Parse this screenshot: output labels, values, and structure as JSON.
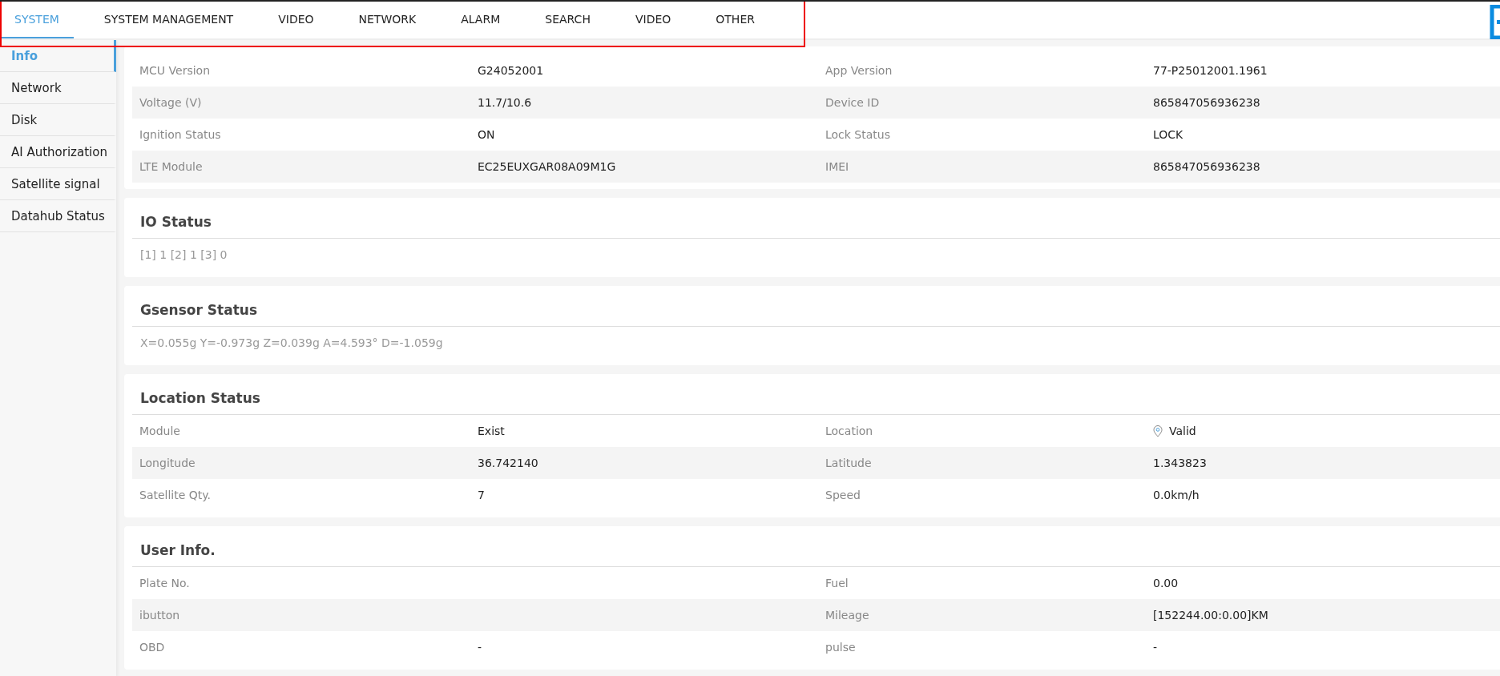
{
  "tabs": [
    {
      "label": "SYSTEM",
      "selected": true
    },
    {
      "label": "SYSTEM MANAGEMENT",
      "selected": false
    },
    {
      "label": "VIDEO",
      "selected": false
    },
    {
      "label": "NETWORK",
      "selected": false
    },
    {
      "label": "ALARM",
      "selected": false
    },
    {
      "label": "SEARCH",
      "selected": false
    },
    {
      "label": "VIDEO",
      "selected": false
    },
    {
      "label": "OTHER",
      "selected": false
    }
  ],
  "sidebar": {
    "items": [
      {
        "label": "Info",
        "selected": true
      },
      {
        "label": "Network",
        "selected": false
      },
      {
        "label": "Disk",
        "selected": false
      },
      {
        "label": "AI Authorization",
        "selected": false
      },
      {
        "label": "Satellite signal",
        "selected": false
      },
      {
        "label": "Datahub Status",
        "selected": false
      }
    ]
  },
  "cards": [
    {
      "kind": "grid",
      "rows": [
        {
          "cells": [
            {
              "label": "MCU Version",
              "value": "G24052001",
              "kind": "text"
            },
            {
              "label": "App Version",
              "value": "77-P25012001.1961",
              "kind": "text"
            }
          ]
        },
        {
          "cells": [
            {
              "label": "Voltage (V)",
              "value": "11.7/10.6",
              "kind": "text"
            },
            {
              "label": "Device ID",
              "value": "865847056936238",
              "kind": "text"
            }
          ]
        },
        {
          "cells": [
            {
              "label": "Ignition Status",
              "value": "ON",
              "kind": "text"
            },
            {
              "label": "Lock Status",
              "value": "LOCK",
              "kind": "text"
            }
          ]
        },
        {
          "cells": [
            {
              "label": "LTE Module",
              "value": "EC25EUXGAR08A09M1G",
              "kind": "text"
            },
            {
              "label": "IMEI",
              "value": "865847056936238",
              "kind": "text"
            }
          ]
        }
      ]
    },
    {
      "kind": "text",
      "title": "IO Status",
      "text": "[1] 1 [2] 1 [3] 0"
    },
    {
      "kind": "text",
      "title": "Gsensor Status",
      "text": "X=0.055g Y=-0.973g Z=0.039g A=4.593° D=-1.059g"
    },
    {
      "kind": "grid",
      "title": "Location Status",
      "rows": [
        {
          "cells": [
            {
              "label": "Module",
              "value": "Exist",
              "kind": "text"
            },
            {
              "label": "Location",
              "value": "Valid",
              "kind": "pin"
            }
          ]
        },
        {
          "cells": [
            {
              "label": "Longitude",
              "value": "36.742140",
              "kind": "text"
            },
            {
              "label": "Latitude",
              "value": "1.343823",
              "kind": "text"
            }
          ]
        },
        {
          "cells": [
            {
              "label": "Satellite Qty.",
              "value": "7",
              "kind": "text"
            },
            {
              "label": "Speed",
              "value": "0.0km/h",
              "kind": "text"
            }
          ]
        }
      ]
    },
    {
      "kind": "grid",
      "title": "User Info.",
      "rows": [
        {
          "cells": [
            {
              "label": "Plate No.",
              "kind": "text"
            },
            {
              "label": "Fuel",
              "value": "0.00",
              "kind": "text"
            }
          ]
        },
        {
          "cells": [
            {
              "label": "ibutton",
              "kind": "text"
            },
            {
              "label": "Mileage",
              "value": "[152244.00:0.00]KM",
              "kind": "text"
            }
          ]
        },
        {
          "cells": [
            {
              "label": "OBD",
              "value": "-",
              "kind": "text"
            },
            {
              "label": "pulse",
              "value": "-",
              "kind": "text"
            }
          ]
        }
      ]
    }
  ]
}
